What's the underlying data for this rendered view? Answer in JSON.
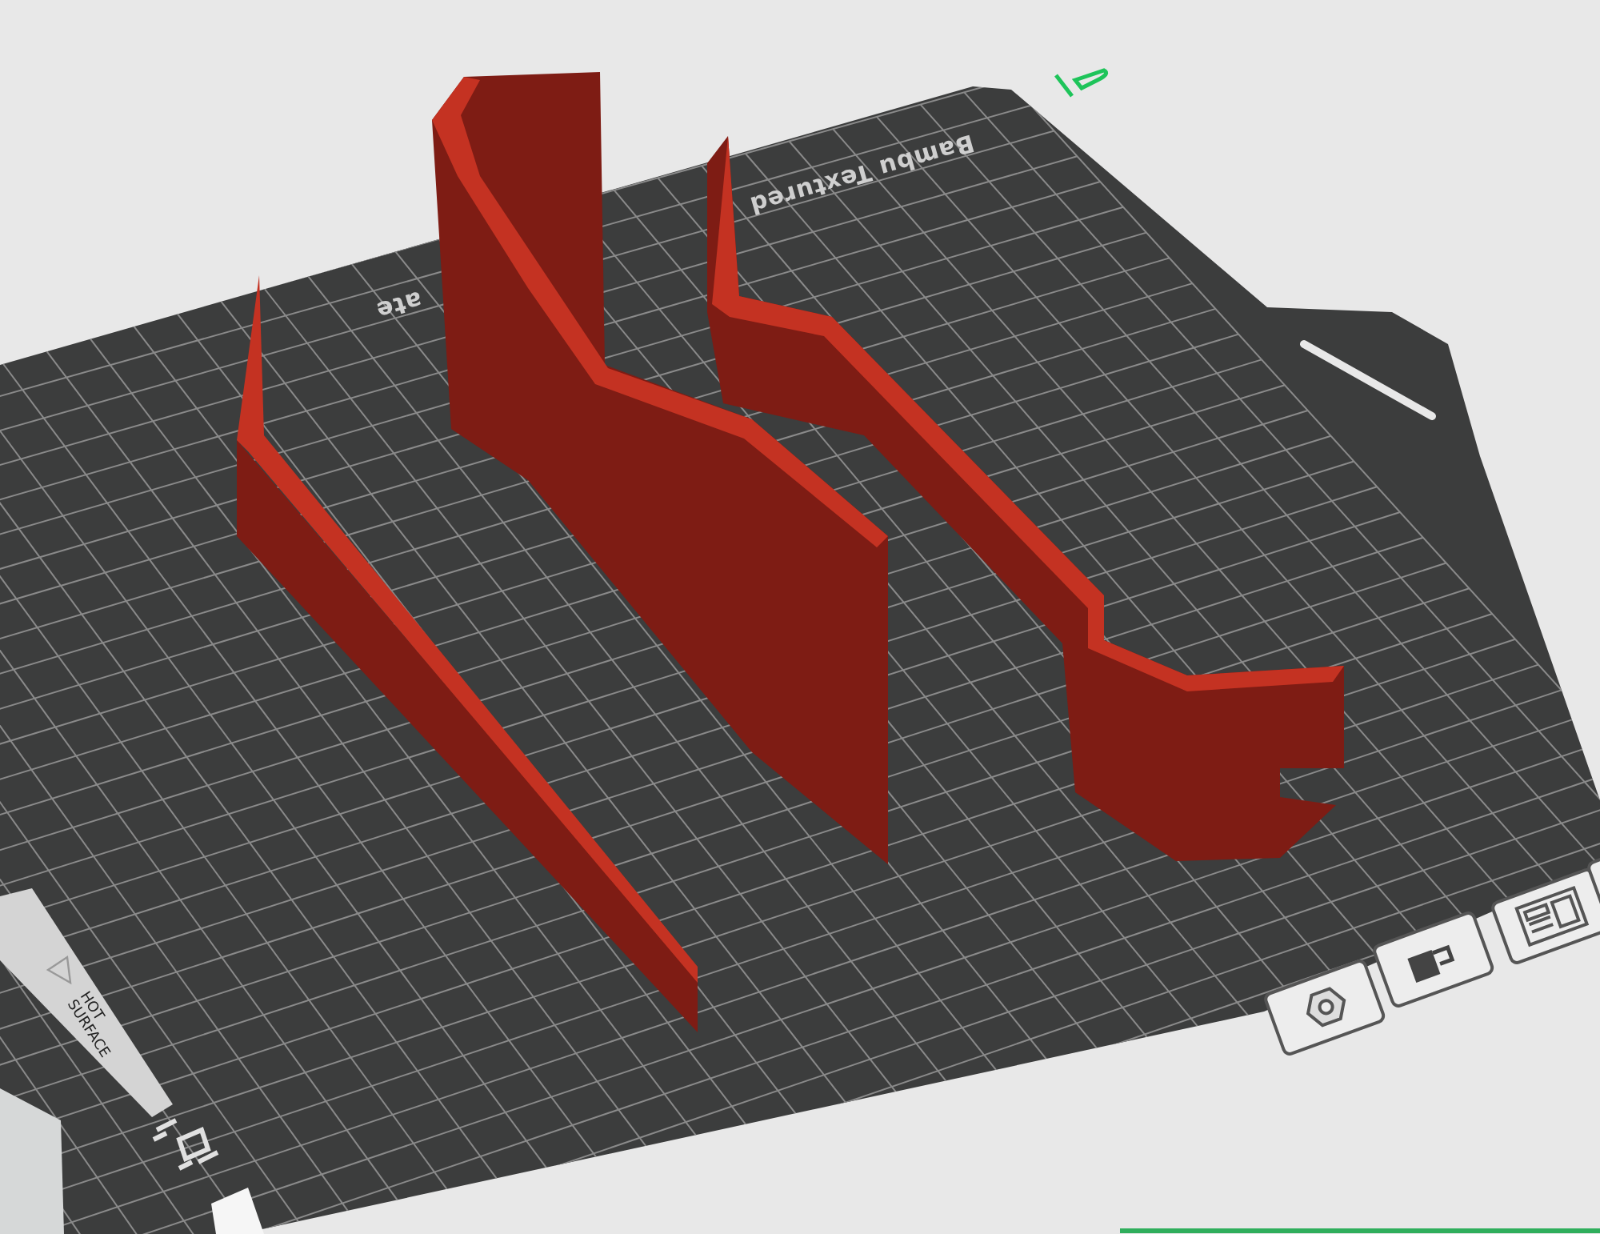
{
  "build_plate": {
    "label_parts": [
      "Bambu Textured",
      "ate"
    ],
    "warning_label": [
      "HOT",
      "SURFACE"
    ]
  }
}
